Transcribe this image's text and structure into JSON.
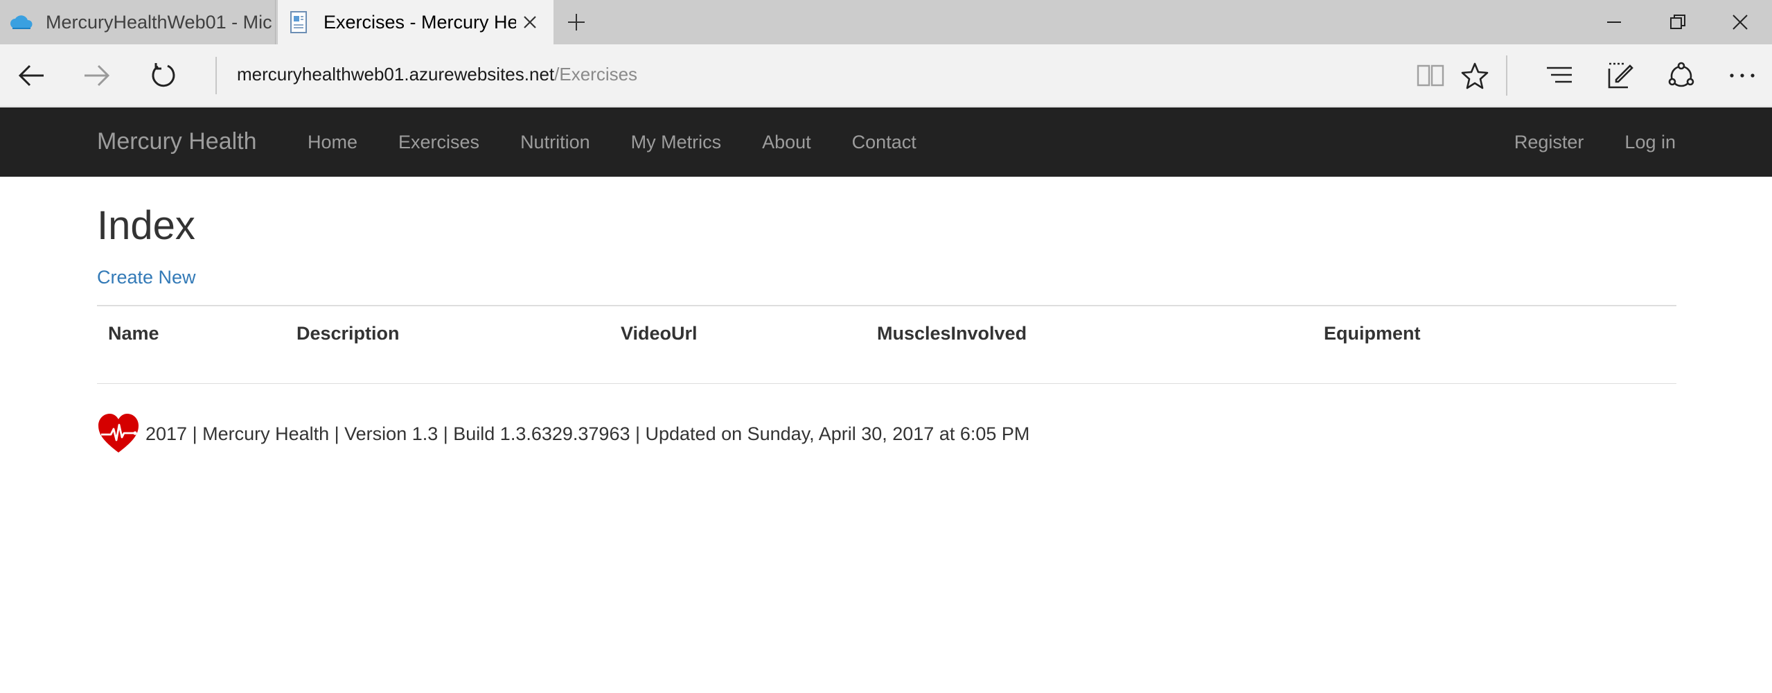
{
  "browser": {
    "tabs": [
      {
        "title": "MercuryHealthWeb01 - Mic",
        "favicon": "cloud-icon",
        "active": false
      },
      {
        "title": "Exercises - Mercury Hea",
        "favicon": "page-icon",
        "active": true
      }
    ],
    "url_host": "mercuryhealthweb01.azurewebsites.net",
    "url_path": "/Exercises",
    "toolbar_icons": [
      "reading-view-icon",
      "favorite-star-icon",
      "hub-icon",
      "web-note-icon",
      "share-icon",
      "more-icon"
    ]
  },
  "navbar": {
    "brand": "Mercury Health",
    "links": [
      "Home",
      "Exercises",
      "Nutrition",
      "My Metrics",
      "About",
      "Contact"
    ],
    "right_links": [
      "Register",
      "Log in"
    ],
    "background": "#222222",
    "link_color": "#9d9d9d"
  },
  "page": {
    "title": "Index",
    "create_link": "Create New",
    "link_color": "#337ab7",
    "table_headers": [
      "Name",
      "Description",
      "VideoUrl",
      "MusclesInvolved",
      "Equipment"
    ]
  },
  "footer": {
    "icon": "heart-pulse-icon",
    "text": "2017 | Mercury Health | Version 1.3 | Build 1.3.6329.37963 | Updated on Sunday, April 30, 2017 at 6:05 PM",
    "icon_color": "#d50000"
  }
}
